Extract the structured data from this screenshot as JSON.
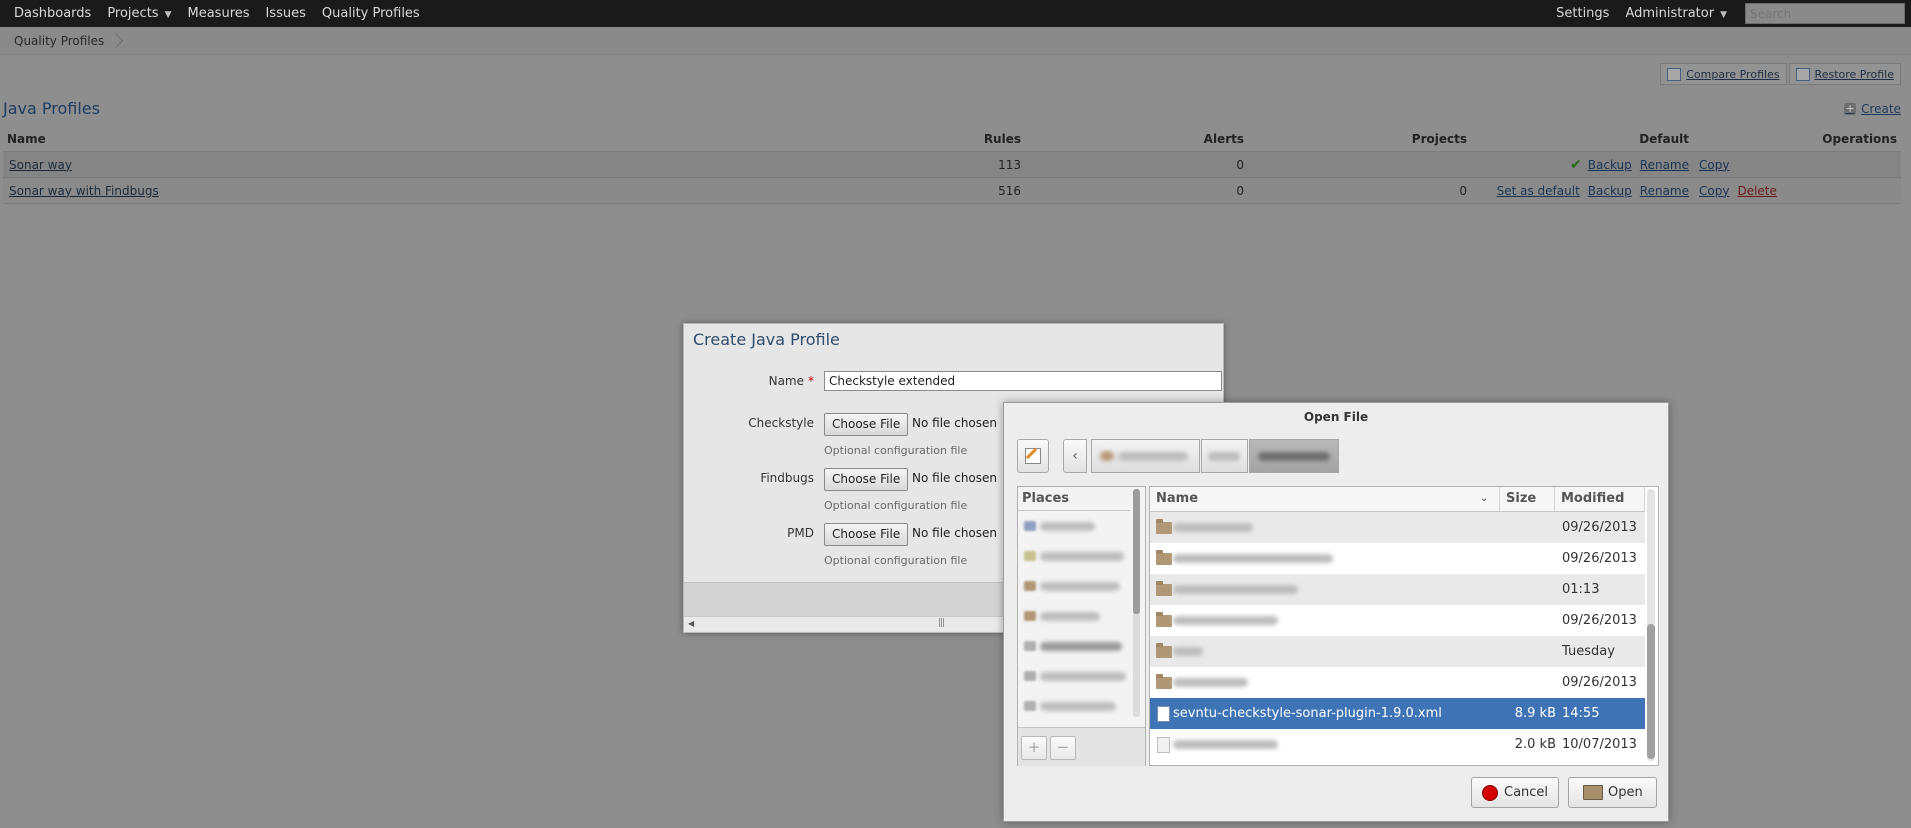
{
  "topnav": {
    "items": [
      {
        "label": "Dashboards"
      },
      {
        "label": "Projects",
        "has_caret": true
      },
      {
        "label": "Measures"
      },
      {
        "label": "Issues"
      },
      {
        "label": "Quality Profiles"
      }
    ],
    "settings": "Settings",
    "user": "Administrator",
    "search_placeholder": "Search"
  },
  "breadcrumb": {
    "item": "Quality Profiles"
  },
  "actions": {
    "compare": "Compare Profiles",
    "restore": "Restore Profile"
  },
  "section": {
    "title": "Java Profiles",
    "create": "Create"
  },
  "profiles_table": {
    "headers": {
      "name": "Name",
      "rules": "Rules",
      "alerts": "Alerts",
      "projects": "Projects",
      "default": "Default",
      "operations": "Operations"
    },
    "rows": [
      {
        "name": "Sonar way",
        "rules": "113",
        "alerts": "0",
        "projects": "",
        "is_default": true,
        "ops": {
          "set_default": "",
          "backup": "Backup",
          "rename": "Rename",
          "copy": "Copy",
          "delete": ""
        }
      },
      {
        "name": "Sonar way with Findbugs",
        "rules": "516",
        "alerts": "0",
        "projects": "0",
        "is_default": false,
        "ops": {
          "set_default": "Set as default",
          "backup": "Backup",
          "rename": "Rename",
          "copy": "Copy",
          "delete": "Delete"
        }
      }
    ]
  },
  "create_dialog": {
    "title": "Create Java Profile",
    "name_label": "Name",
    "required_mark": "*",
    "name_value": "Checkstyle extended",
    "checkstyle_label": "Checkstyle",
    "findbugs_label": "Findbugs",
    "pmd_label": "PMD",
    "choose_file": "Choose File",
    "no_file": "No file chosen",
    "hint": "Optional configuration file"
  },
  "open_dialog": {
    "title": "Open File",
    "places_header": "Places",
    "columns": {
      "name": "Name",
      "size": "Size",
      "modified": "Modified"
    },
    "files": [
      {
        "name": "",
        "size": "",
        "modified": "09/26/2013",
        "kind": "folder"
      },
      {
        "name": "",
        "size": "",
        "modified": "09/26/2013",
        "kind": "folder"
      },
      {
        "name": "",
        "size": "",
        "modified": "01:13",
        "kind": "folder"
      },
      {
        "name": "",
        "size": "",
        "modified": "09/26/2013",
        "kind": "folder"
      },
      {
        "name": "",
        "size": "",
        "modified": "Tuesday",
        "kind": "folder"
      },
      {
        "name": "",
        "size": "",
        "modified": "09/26/2013",
        "kind": "folder"
      },
      {
        "name": "sevntu-checkstyle-sonar-plugin-1.9.0.xml",
        "size": "8.9 kB",
        "modified": "14:55",
        "kind": "file",
        "selected": true
      },
      {
        "name": "",
        "size": "2.0 kB",
        "modified": "10/07/2013",
        "kind": "file"
      }
    ],
    "add_button": "+",
    "remove_button": "−",
    "cancel": "Cancel",
    "open": "Open"
  },
  "colors": {
    "selection": "#3e74b6",
    "cancel_icon": "#d40000",
    "check": "#2d6a1a"
  },
  "icons": [
    "chevron-down-icon",
    "breadcrumb-chevron-icon",
    "compare-icon",
    "restore-icon",
    "plus-icon",
    "checkmark-icon",
    "edit-path-icon",
    "back-chevron-icon",
    "folder-icon",
    "xml-file-icon",
    "stop-icon",
    "open-folder-icon"
  ]
}
